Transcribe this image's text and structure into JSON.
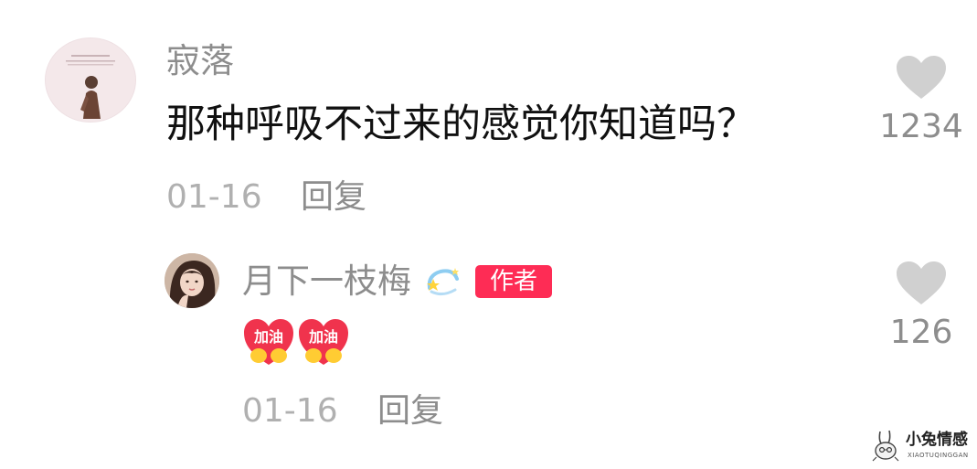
{
  "comment": {
    "username": "寂落",
    "text": "那种呼吸不过来的感觉你知道吗？",
    "date": "01-16",
    "reply_label": "回复",
    "likes": "1234"
  },
  "reply": {
    "username": "月下一枝梅",
    "author_badge": "作者",
    "emojis": [
      {
        "name": "jiayou",
        "text": "加油"
      },
      {
        "name": "jiayou",
        "text": "加油"
      }
    ],
    "date": "01-16",
    "reply_label": "回复",
    "likes": "126"
  },
  "watermark": {
    "title": "小兔情感",
    "subtitle": "XIAOTUQINGGAN"
  },
  "colors": {
    "author_badge": "#fe2c55",
    "like_icon": "#d0d0d0",
    "username": "#8d8d8d",
    "date": "#b0b0b0",
    "text": "#111111",
    "emoji_heart": "#f0334d",
    "emoji_hands": "#ffcc33"
  }
}
